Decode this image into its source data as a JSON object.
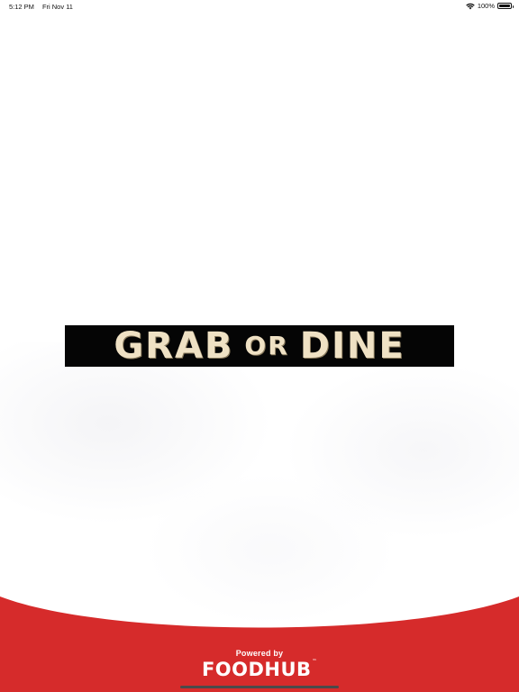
{
  "status_bar": {
    "time": "5:12 PM",
    "date": "Fri Nov 11",
    "battery": "100%",
    "icons": [
      "wifi-icon",
      "battery-icon"
    ]
  },
  "logo": {
    "word1": "GRAB",
    "word2": "OR",
    "word3": "DINE"
  },
  "footer": {
    "powered_by": "Powered by",
    "brand": "FOODHUB",
    "trademark": "™"
  },
  "colors": {
    "footer_red": "#d62b2b",
    "logo_background": "#050505",
    "logo_text": "#efe1c4"
  }
}
